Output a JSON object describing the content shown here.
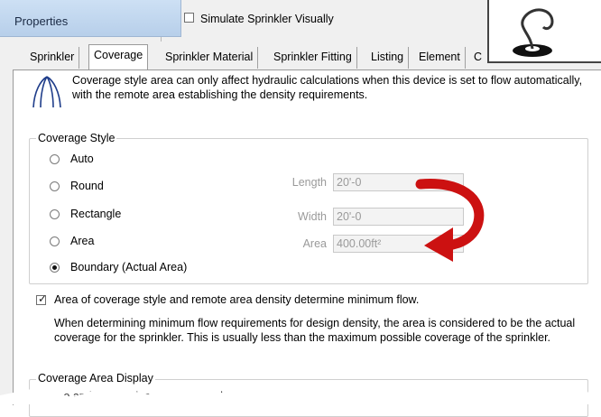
{
  "window": {
    "title": "Properties"
  },
  "background_panel": {
    "checkbox_label": "Simulate Sprinkler Visually",
    "checked": false
  },
  "tabs": [
    {
      "label": "Sprinkler",
      "active": false
    },
    {
      "label": "Coverage",
      "active": true
    },
    {
      "label": "Sprinkler Material",
      "active": false
    },
    {
      "label": "Sprinkler Fitting",
      "active": false
    },
    {
      "label": "Listing",
      "active": false
    },
    {
      "label": "Element",
      "active": false
    },
    {
      "label": "C",
      "active": false
    }
  ],
  "description": "Coverage style area can only affect hydraulic calculations when this device is set to flow automatically, with the remote area establishing the density requirements.",
  "coverage_style": {
    "legend": "Coverage Style",
    "options": [
      {
        "label": "Auto",
        "selected": false
      },
      {
        "label": "Round",
        "selected": false
      },
      {
        "label": "Rectangle",
        "selected": false
      },
      {
        "label": "Area",
        "selected": false
      },
      {
        "label": "Boundary (Actual Area)",
        "selected": true
      }
    ],
    "fields": {
      "length_label": "Length",
      "length_value": "20'-0",
      "width_label": "Width",
      "width_value": "20'-0",
      "area_label": "Area",
      "area_value": "400.00ft²"
    }
  },
  "min_flow": {
    "checked": true,
    "label": "Area of coverage style and remote area density determine minimum flow.",
    "note": "When determining minimum flow requirements for design density, the area is considered to be the actual coverage for the sprinkler. This is usually less than the maximum possible coverage of the sprinkler."
  },
  "coverage_display": {
    "legend": "Coverage Area Display",
    "partial_text": "...o and Area styles ... ...displayed."
  },
  "colors": {
    "accent_arrow": "#cc1111",
    "title_gradient_top": "#cde0f4",
    "title_gradient_bottom": "#b7cfea"
  }
}
